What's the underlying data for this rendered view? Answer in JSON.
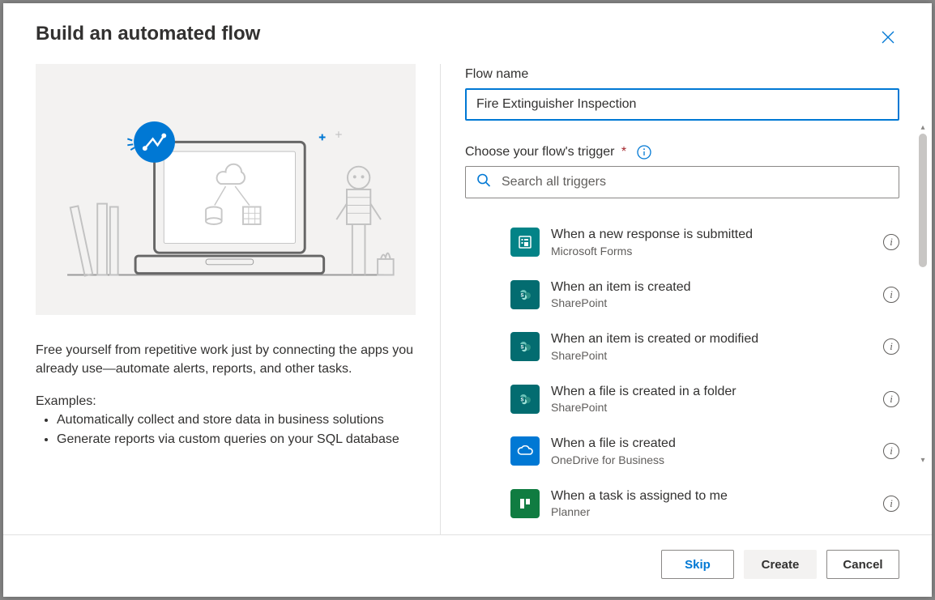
{
  "dialog": {
    "title": "Build an automated flow"
  },
  "left": {
    "description": "Free yourself from repetitive work just by connecting the apps you already use—automate alerts, reports, and other tasks.",
    "examples_heading": "Examples:",
    "examples": [
      "Automatically collect and store data in business solutions",
      "Generate reports via custom queries on your SQL database"
    ]
  },
  "form": {
    "flowname_label": "Flow name",
    "flowname_value": "Fire Extinguisher Inspection",
    "trigger_label": "Choose your flow's trigger",
    "search_placeholder": "Search all triggers"
  },
  "triggers": [
    {
      "title": "When a new response is submitted",
      "connector": "Microsoft Forms",
      "icon": "forms"
    },
    {
      "title": "When an item is created",
      "connector": "SharePoint",
      "icon": "sp"
    },
    {
      "title": "When an item is created or modified",
      "connector": "SharePoint",
      "icon": "sp"
    },
    {
      "title": "When a file is created in a folder",
      "connector": "SharePoint",
      "icon": "sp"
    },
    {
      "title": "When a file is created",
      "connector": "OneDrive for Business",
      "icon": "od"
    },
    {
      "title": "When a task is assigned to me",
      "connector": "Planner",
      "icon": "planner"
    }
  ],
  "footer": {
    "skip": "Skip",
    "create": "Create",
    "cancel": "Cancel"
  }
}
